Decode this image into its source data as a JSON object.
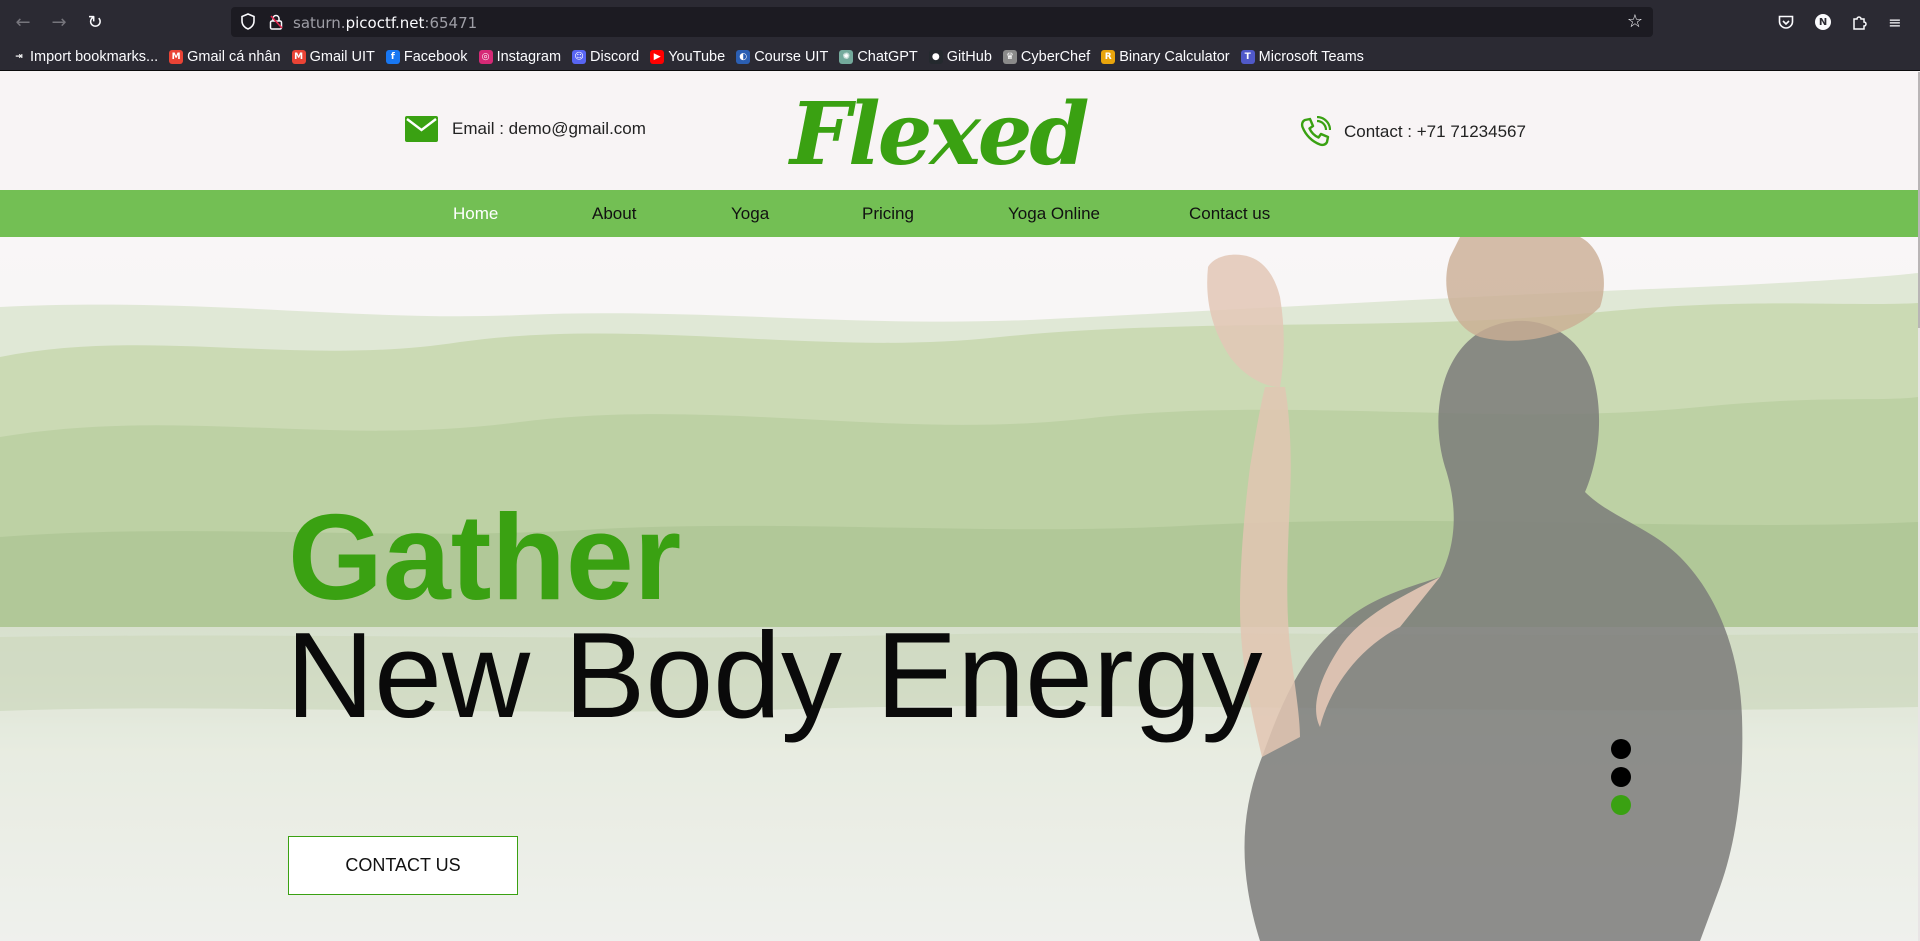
{
  "browser": {
    "url_host_prefix": "saturn.",
    "url_host_main": "picoctf.net",
    "url_port": ":65471",
    "profile_initial": "N"
  },
  "bookmarks": [
    {
      "label": "Import bookmarks...",
      "icon": "import-icon",
      "color": "#2b2a33",
      "glyph": "⇥"
    },
    {
      "label": "Gmail cá nhân",
      "icon": "gmail-icon",
      "color": "#ea4335",
      "glyph": "M"
    },
    {
      "label": "Gmail UIT",
      "icon": "gmail-icon",
      "color": "#ea4335",
      "glyph": "M"
    },
    {
      "label": "Facebook",
      "icon": "facebook-icon",
      "color": "#1877f2",
      "glyph": "f"
    },
    {
      "label": "Instagram",
      "icon": "instagram-icon",
      "color": "#d62976",
      "glyph": "◎"
    },
    {
      "label": "Discord",
      "icon": "discord-icon",
      "color": "#5865f2",
      "glyph": "☺"
    },
    {
      "label": "YouTube",
      "icon": "youtube-icon",
      "color": "#ff0000",
      "glyph": "▶"
    },
    {
      "label": "Course UIT",
      "icon": "course-uit-icon",
      "color": "#2b5fb3",
      "glyph": "◐"
    },
    {
      "label": "ChatGPT",
      "icon": "chatgpt-icon",
      "color": "#74aa9c",
      "glyph": "✺"
    },
    {
      "label": "GitHub",
      "icon": "github-icon",
      "color": "#24292e",
      "glyph": "●"
    },
    {
      "label": "CyberChef",
      "icon": "cyberchef-icon",
      "color": "#8a8a8a",
      "glyph": "♛"
    },
    {
      "label": "Binary Calculator",
      "icon": "binary-calculator-icon",
      "color": "#e8a40c",
      "glyph": "R"
    },
    {
      "label": "Microsoft Teams",
      "icon": "teams-icon",
      "color": "#5059c9",
      "glyph": "T"
    }
  ],
  "site": {
    "email_text": "Email : demo@gmail.com",
    "logo": "Flexed",
    "contact_text": "Contact : +71 71234567",
    "nav": [
      {
        "label": "Home",
        "active": true
      },
      {
        "label": "About",
        "active": false
      },
      {
        "label": "Yoga",
        "active": false
      },
      {
        "label": "Pricing",
        "active": false
      },
      {
        "label": "Yoga Online",
        "active": false
      },
      {
        "label": "Contact us",
        "active": false
      }
    ],
    "hero": {
      "line1": "Gather",
      "line2": "New Body Energy",
      "button": "CONTACT US",
      "slides_total": 3,
      "active_slide": 3
    }
  },
  "colors": {
    "brand_green": "#3aa112",
    "menu_green": "#73bf54",
    "chrome_bg": "#2b2a33"
  }
}
